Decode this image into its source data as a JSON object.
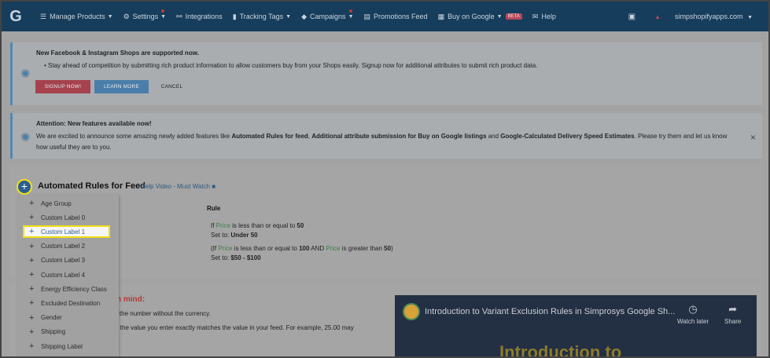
{
  "nav": {
    "logo": "G",
    "items": [
      {
        "label": "Manage Products",
        "icon": "list-icon",
        "glyph": "☰",
        "caret": true
      },
      {
        "label": "Settings",
        "icon": "gear-icon",
        "glyph": "⚙",
        "caret": true,
        "dot": true
      },
      {
        "label": "Integrations",
        "icon": "plug-icon",
        "glyph": "⚯",
        "caret": false
      },
      {
        "label": "Tracking Tags",
        "icon": "chart-icon",
        "glyph": "▮",
        "caret": true
      },
      {
        "label": "Campaigns",
        "icon": "tag-icon",
        "glyph": "◆",
        "caret": true,
        "dot": true
      },
      {
        "label": "Promotions Feed",
        "icon": "doc-icon",
        "glyph": "▤",
        "caret": false
      },
      {
        "label": "Buy on Google",
        "icon": "cart-icon",
        "glyph": "▦",
        "caret": true,
        "badge": "BETA"
      },
      {
        "label": "Help",
        "icon": "comment-icon",
        "glyph": "✉",
        "caret": false
      }
    ],
    "store": "simpshopifyapps.com"
  },
  "banner1": {
    "title": "New Facebook & Instagram Shops are supported now.",
    "text": "Stay ahead of competition by submitting rich product information to allow customers buy from your Shops easily. Signup now for additional attributes to submit rich product data.",
    "signup": "Signup now!",
    "learn": "Learn more",
    "cancel": "Cancel"
  },
  "banner2": {
    "title": "Attention: New features available now!",
    "text_a": "We are excited to announce some amazing newly added features like ",
    "text_b": "Automated Rules for feed",
    "text_c": ", ",
    "text_d": "Additional attribute submission for Buy on Google listings",
    "text_e": " and ",
    "text_f": "Google-Calculated Delivery Speed Estimates",
    "text_g": ". Please try them and let us know",
    "text_h": "how useful they are to you.",
    "close": "×"
  },
  "rules": {
    "add": "+",
    "title": "Automated Rules for Feed",
    "help": "Help Video - Must Watch",
    "rule_header": "Rule",
    "r1_if": "If ",
    "r1_field": "Price",
    "r1_cond": " is less than or equal to ",
    "r1_val": "50",
    "r1_set": "Set to: ",
    "r1_setval": "Under 50",
    "r2_open": "(If ",
    "r2_field": "Price",
    "r2_cond": " is less than or equal to ",
    "r2_val": "100",
    "r2_and": " AND ",
    "r2_field2": "Price",
    "r2_cond2": " is greater than ",
    "r2_val2": "50",
    "r2_close": ")",
    "r2_set": "Set to: ",
    "r2_setval": "$50 - $100"
  },
  "dropdown": {
    "highlighted_index": 2,
    "items": [
      "Age Group",
      "Custom Label 0",
      "Custom Label 1",
      "Custom Label 2",
      "Custom Label 3",
      "Custom Label 4",
      "Energy Efficiency Class",
      "Excluded Destination",
      "Gender",
      "Shipping",
      "Shipping Label"
    ]
  },
  "bottom": {
    "heading": "n mind:",
    "line1": "only the number without the currency.",
    "line2": "sure the value you enter exactly matches the value in your feed. For example, 25.00 may"
  },
  "video": {
    "title": "Introduction to Variant Exclusion Rules in Simprosys Google Sh...",
    "watch_later": "Watch later",
    "share": "Share",
    "big_text": "Introduction to"
  }
}
